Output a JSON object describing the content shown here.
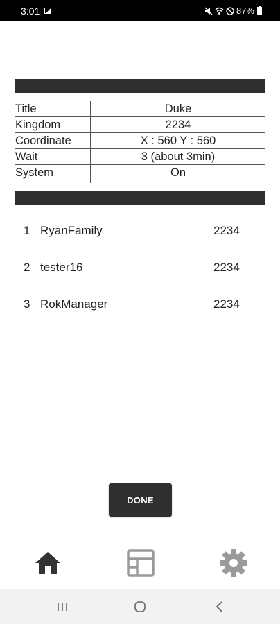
{
  "status_bar": {
    "time": "3:01",
    "battery": "87%",
    "icons": [
      "photo-icon",
      "mute-icon",
      "wifi-icon",
      "do-not-disturb-icon",
      "battery-icon"
    ]
  },
  "info": {
    "rows": [
      {
        "key": "Title",
        "value": "Duke"
      },
      {
        "key": "Kingdom",
        "value": "2234"
      },
      {
        "key": "Coordinate",
        "value": "X : 560 Y : 560"
      },
      {
        "key": "Wait",
        "value": "3 (about 3min)"
      },
      {
        "key": "System",
        "value": "On"
      }
    ]
  },
  "ranking": [
    {
      "rank": "1",
      "name": "RyanFamily",
      "value": "2234"
    },
    {
      "rank": "2",
      "name": "tester16",
      "value": "2234"
    },
    {
      "rank": "3",
      "name": "RokManager",
      "value": "2234"
    }
  ],
  "done_label": "DONE",
  "bottom_nav": {
    "items": [
      "home-icon",
      "list-icon",
      "settings-icon"
    ]
  },
  "system_nav": {
    "buttons": [
      "recents-icon",
      "home-circle-icon",
      "back-icon"
    ]
  },
  "colors": {
    "bar": "#2f2f2f",
    "button": "#2f2f2f",
    "nav_active": "#333333",
    "nav_inactive": "#9a9a9a"
  }
}
